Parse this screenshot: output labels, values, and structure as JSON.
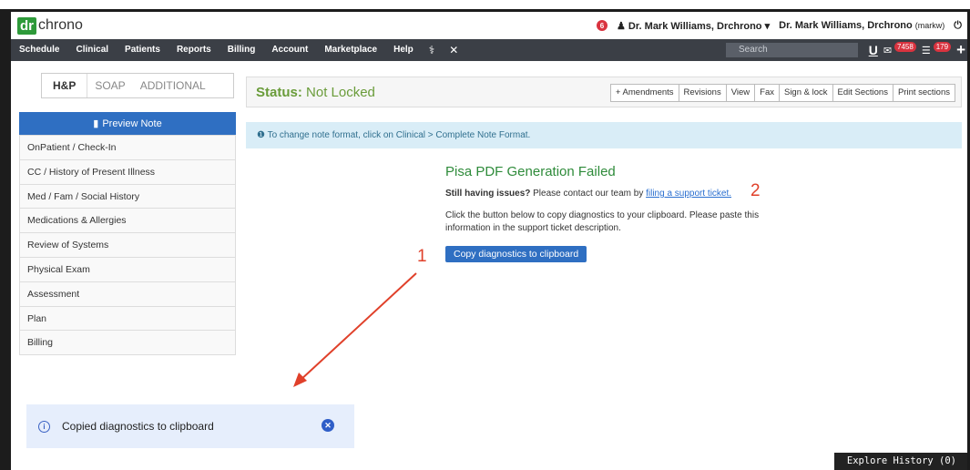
{
  "header": {
    "logo_dr": "dr",
    "logo_chrono": "chrono",
    "notification_count": "6",
    "user_name": "Dr. Mark Williams, Drchrono",
    "caret": "▾",
    "practice_name": "Dr. Mark Williams, Drchrono",
    "practice_user": "(markw)"
  },
  "nav": {
    "items": [
      "Schedule",
      "Clinical",
      "Patients",
      "Reports",
      "Billing",
      "Account",
      "Marketplace",
      "Help"
    ],
    "search_placeholder": "Search",
    "messages_badge": "7458",
    "tasks_badge": "179"
  },
  "left": {
    "tabs": [
      "H&P",
      "SOAP",
      "ADDITIONAL"
    ],
    "preview_label": "Preview Note",
    "sections": [
      "OnPatient / Check-In",
      "CC / History of Present Illness",
      "Med / Fam / Social History",
      "Medications & Allergies",
      "Review of Systems",
      "Physical Exam",
      "Assessment",
      "Plan",
      "Billing"
    ]
  },
  "status": {
    "label": "Status:",
    "value": "Not Locked",
    "buttons": [
      "+ Amendments",
      "Revisions",
      "View",
      "Fax",
      "Sign & lock",
      "Edit Sections",
      "Print sections"
    ]
  },
  "info": {
    "text": "To change note format, click on Clinical > Complete Note Format."
  },
  "error": {
    "title": "Pisa PDF Generation Failed",
    "still_bold": "Still having issues?",
    "still_rest": " Please contact our team by ",
    "link": "filing a support ticket.",
    "para": "Click the button below to copy diagnostics to your clipboard. Please paste this information in the support ticket description.",
    "copy_button": "Copy diagnostics to clipboard"
  },
  "annotations": {
    "one": "1",
    "two": "2",
    "color": "#e0402a"
  },
  "toast": {
    "text": "Copied diagnostics to clipboard"
  },
  "explore": {
    "label": "Explore History (0)"
  }
}
